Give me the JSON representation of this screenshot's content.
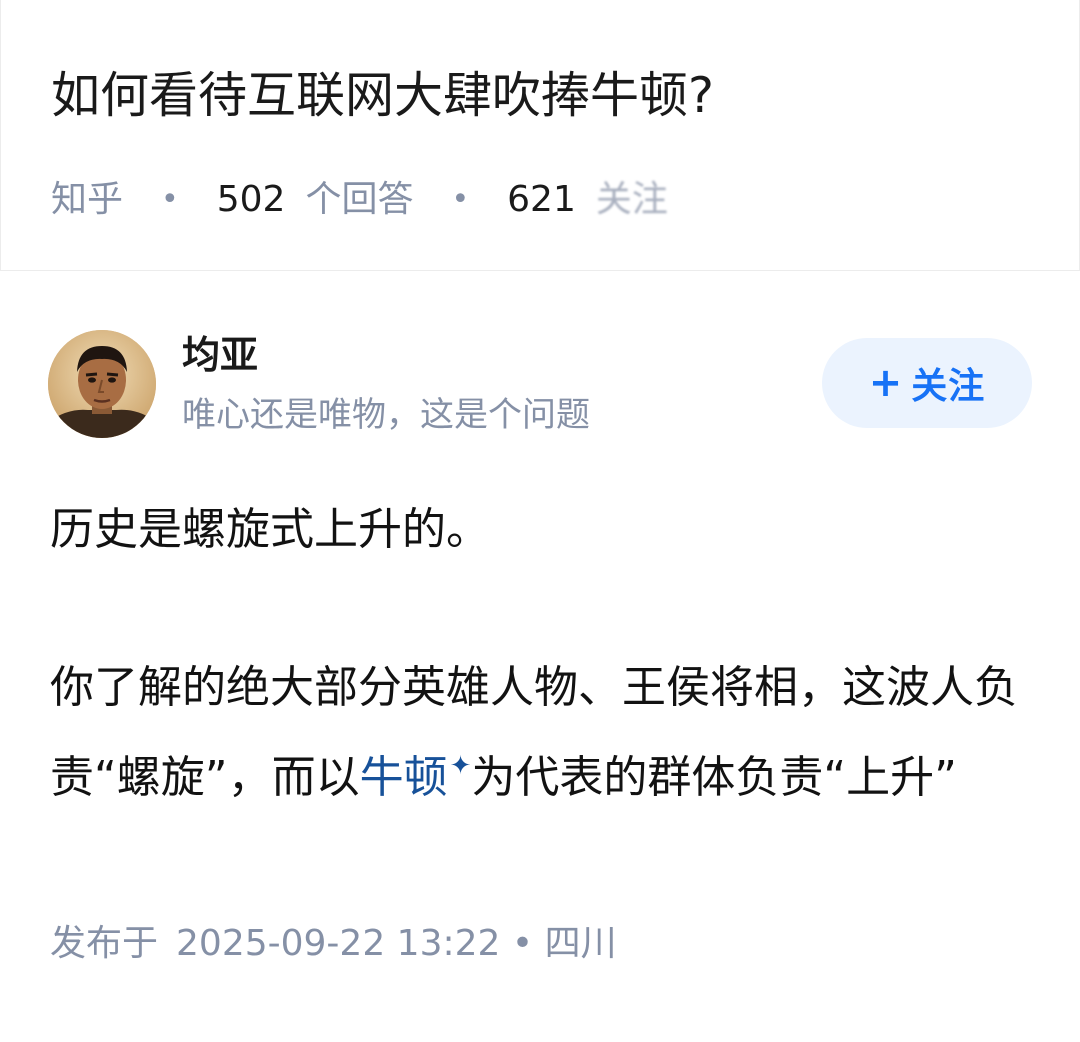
{
  "question": {
    "title": "如何看待互联网大肆吹捧牛顿?",
    "source": "知乎",
    "answer_count": "502",
    "answer_label": "个回答",
    "follower_count": "621",
    "follower_label": "关注",
    "separator": "•"
  },
  "author": {
    "name": "均亚",
    "bio": "唯心还是唯物，这是个问题",
    "avatar_icon": "portrait-avatar"
  },
  "follow_button": {
    "plus": "+",
    "label": "关注"
  },
  "answer": {
    "paragraph1": "历史是螺旋式上升的。",
    "paragraph2_part1": "你了解的绝大部分英雄人物、王侯将相，这波人负责“螺旋”，而以",
    "keyword": "牛顿",
    "paragraph2_part2": "为代表的群体负责“上升”"
  },
  "publish": {
    "prefix": "发布于",
    "datetime": "2025-09-22  13:22",
    "separator": "•",
    "location": "四川"
  },
  "colors": {
    "text": "#121212",
    "meta_gray": "#8590a6",
    "link_blue": "#175199",
    "button_blue": "#1772f6",
    "button_bg": "#ebf3fe"
  }
}
